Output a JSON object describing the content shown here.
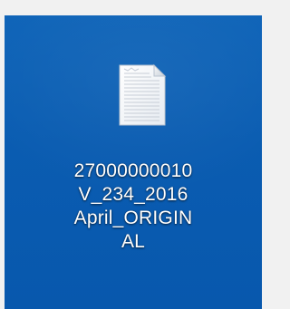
{
  "desktop": {
    "background_color": "#0b5db2",
    "file": {
      "icon": "text-document-icon",
      "name_lines": [
        "27000000010",
        "V_234_2016",
        "April_ORIGIN",
        "AL"
      ]
    }
  }
}
